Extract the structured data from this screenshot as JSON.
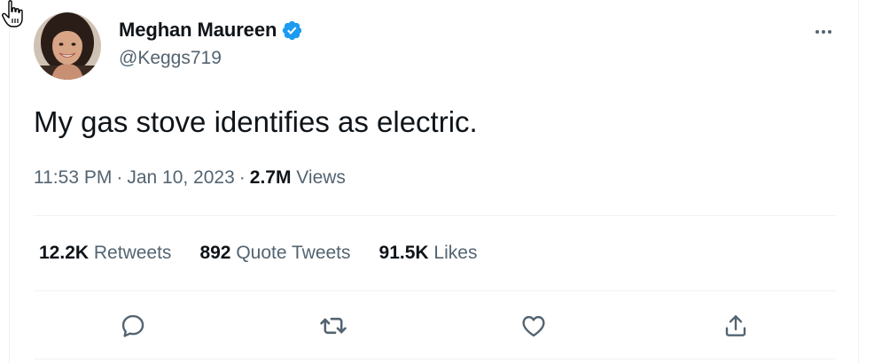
{
  "user": {
    "display_name": "Meghan Maureen",
    "handle": "@Keggs719",
    "verified": true
  },
  "tweet": {
    "text": "My gas stove identifies as electric.",
    "time": "11:53 PM",
    "separator": "·",
    "date": "Jan 10, 2023",
    "views_count": "2.7M",
    "views_label": "Views"
  },
  "stats": [
    {
      "count": "12.2K",
      "label": "Retweets"
    },
    {
      "count": "892",
      "label": "Quote Tweets"
    },
    {
      "count": "91.5K",
      "label": "Likes"
    }
  ],
  "actions": [
    "reply-icon",
    "retweet-icon",
    "like-icon",
    "share-icon"
  ],
  "colors": {
    "text_primary": "#0f1419",
    "text_secondary": "#536471",
    "verified_blue": "#1d9bf0",
    "divider": "#eff3f4"
  }
}
